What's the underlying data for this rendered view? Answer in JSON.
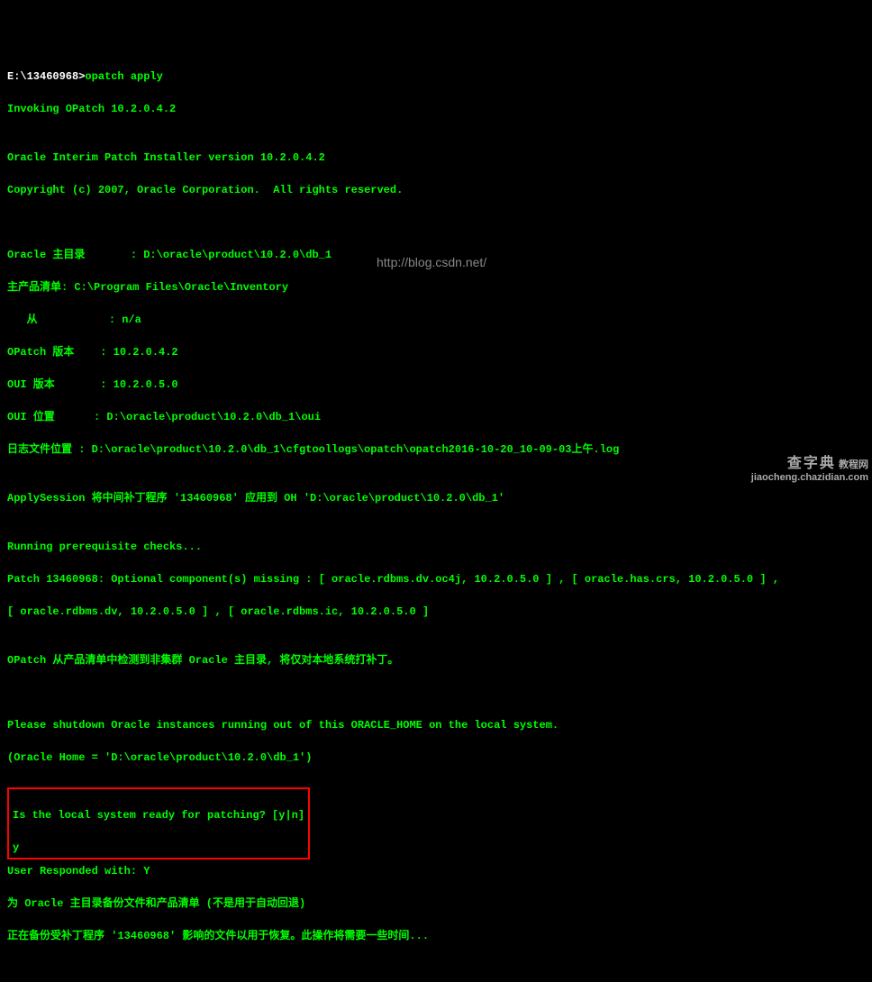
{
  "prompt_line": {
    "path": "E:\\13460968>",
    "cmd": "opatch apply"
  },
  "l01": "Invoking OPatch 10.2.0.4.2",
  "l02": "",
  "l03": "Oracle Interim Patch Installer version 10.2.0.4.2",
  "l04": "Copyright (c) 2007, Oracle Corporation.  All rights reserved.",
  "l05": "",
  "l06": "",
  "l07": "Oracle 主目录       : D:\\oracle\\product\\10.2.0\\db_1",
  "l08": "主产品清单: C:\\Program Files\\Oracle\\Inventory",
  "l09": "   从           : n/a",
  "l10": "OPatch 版本    : 10.2.0.4.2",
  "l11": "OUI 版本       : 10.2.0.5.0",
  "l12": "OUI 位置      : D:\\oracle\\product\\10.2.0\\db_1\\oui",
  "l13": "日志文件位置 : D:\\oracle\\product\\10.2.0\\db_1\\cfgtoollogs\\opatch\\opatch2016-10-20_10-09-03上午.log",
  "l14": "",
  "l15": "ApplySession 将中间补丁程序 '13460968' 应用到 OH 'D:\\oracle\\product\\10.2.0\\db_1'",
  "l16": "",
  "l17": "Running prerequisite checks...",
  "l18": "Patch 13460968: Optional component(s) missing : [ oracle.rdbms.dv.oc4j, 10.2.0.5.0 ] , [ oracle.has.crs, 10.2.0.5.0 ] , ",
  "l19": "[ oracle.rdbms.dv, 10.2.0.5.0 ] , [ oracle.rdbms.ic, 10.2.0.5.0 ]",
  "l20": "",
  "l21": "OPatch 从产品清单中检测到非集群 Oracle 主目录, 将仅对本地系统打补丁。",
  "l22": "",
  "l23": "",
  "l24": "Please shutdown Oracle instances running out of this ORACLE_HOME on the local system.",
  "l25": "(Oracle Home = 'D:\\oracle\\product\\10.2.0\\db_1')",
  "prompt_q": "Is the local system ready for patching? [y|n]",
  "prompt_a": "y",
  "l26": "User Responded with: Y",
  "l27": "为 Oracle 主目录备份文件和产品清单 (不是用于自动回退)",
  "l28": "正在备份受补丁程序 '13460968' 影响的文件以用于恢复。此操作将需要一些时间...",
  "watermark_url": "http://blog.csdn.net/",
  "corner": {
    "brand": "查字典",
    "sub": "教程网",
    "domain": "jiaocheng.chazidian.com"
  }
}
